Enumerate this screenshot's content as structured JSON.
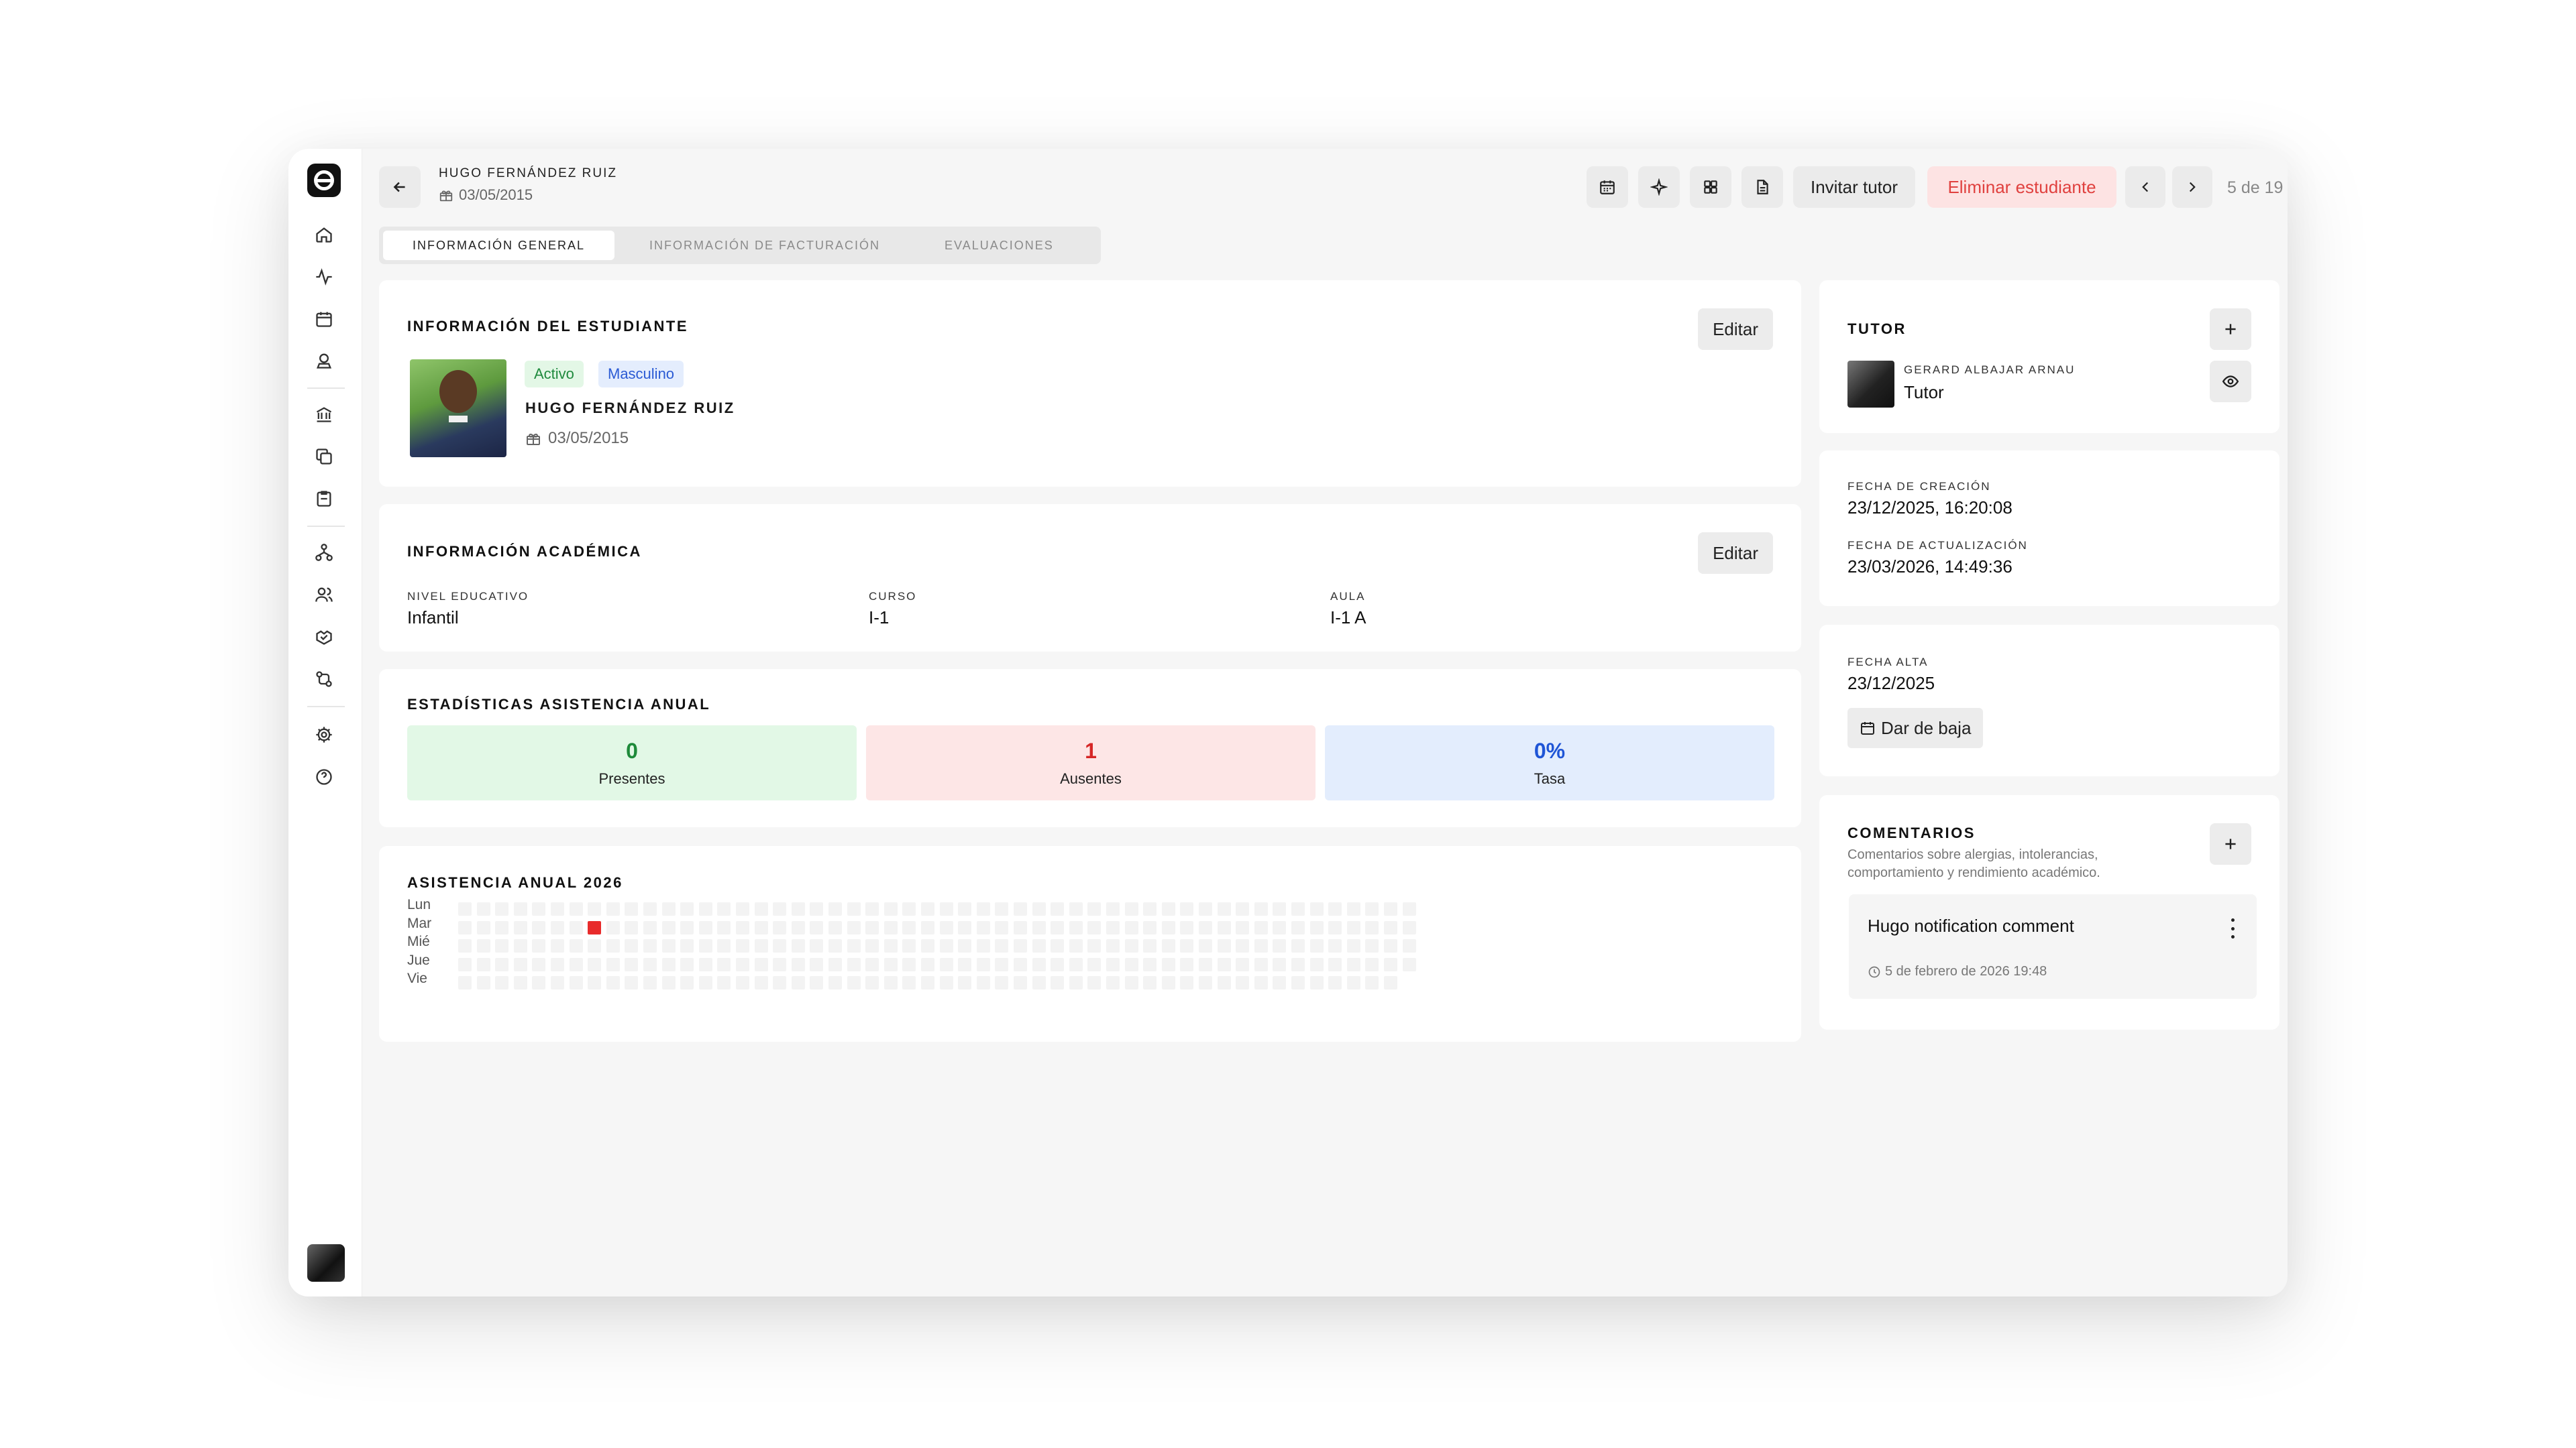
{
  "header": {
    "student_name": "HUGO FERNÁNDEZ RUIZ",
    "birth_date": "03/05/2015",
    "invite_tutor": "Invitar tutor",
    "delete_student": "Eliminar estudiante",
    "pager": "5 de 19"
  },
  "tabs": [
    {
      "label": "INFORMACIÓN GENERAL"
    },
    {
      "label": "INFORMACIÓN DE FACTURACIÓN"
    },
    {
      "label": "EVALUACIONES"
    }
  ],
  "student_info": {
    "title": "INFORMACIÓN DEL ESTUDIANTE",
    "edit": "Editar",
    "status": "Activo",
    "gender": "Masculino",
    "name": "HUGO FERNÁNDEZ RUIZ",
    "birth_date": "03/05/2015"
  },
  "academic_info": {
    "title": "INFORMACIÓN ACADÉMICA",
    "edit": "Editar",
    "fields": [
      {
        "label": "NIVEL EDUCATIVO",
        "value": "Infantil"
      },
      {
        "label": "CURSO",
        "value": "I-1"
      },
      {
        "label": "AULA",
        "value": "I-1 A"
      }
    ]
  },
  "attendance_stats": {
    "title": "ESTADÍSTICAS ASISTENCIA ANUAL",
    "present": {
      "value": "0",
      "label": "Presentes",
      "color": "#1e8a3a",
      "bg": "#e2f8e6"
    },
    "absent": {
      "value": "1",
      "label": "Ausentes",
      "color": "#d62626",
      "bg": "#fde6e6"
    },
    "rate": {
      "value": "0%",
      "label": "Tasa",
      "color": "#1f55d6",
      "bg": "#e3edfd"
    }
  },
  "attendance_year": {
    "title": "ASISTENCIA ANUAL 2026",
    "days": [
      "Lun",
      "Mar",
      "Mié",
      "Jue",
      "Vie"
    ],
    "absent_color": "#e82b2b"
  },
  "tutor": {
    "title": "TUTOR",
    "name": "GERARD ALBAJAR ARNAU",
    "role": "Tutor"
  },
  "dates": {
    "created_label": "FECHA DE CREACIÓN",
    "created_value": "23/12/2025, 16:20:08",
    "updated_label": "FECHA DE ACTUALIZACIÓN",
    "updated_value": "23/03/2026, 14:49:36"
  },
  "enrollment": {
    "label": "FECHA ALTA",
    "value": "23/12/2025",
    "unenroll": "Dar de baja"
  },
  "comments": {
    "title": "COMENTARIOS",
    "description": "Comentarios sobre alergias, intolerancias, comportamiento y rendimiento académico.",
    "items": [
      {
        "text": "Hugo notification comment",
        "date": "5 de febrero de 2026 19:48"
      }
    ]
  },
  "icons": {
    "back": "arrow-left-icon",
    "calendar": "calendar-icon",
    "sparkle": "sparkle-icon",
    "grid": "grid-icon",
    "document": "document-icon",
    "prev": "chevron-left-icon",
    "next": "chevron-right-icon",
    "gift": "gift-icon",
    "plus": "plus-icon",
    "eye": "eye-icon",
    "clock": "clock-icon",
    "more": "more-vertical-icon"
  }
}
